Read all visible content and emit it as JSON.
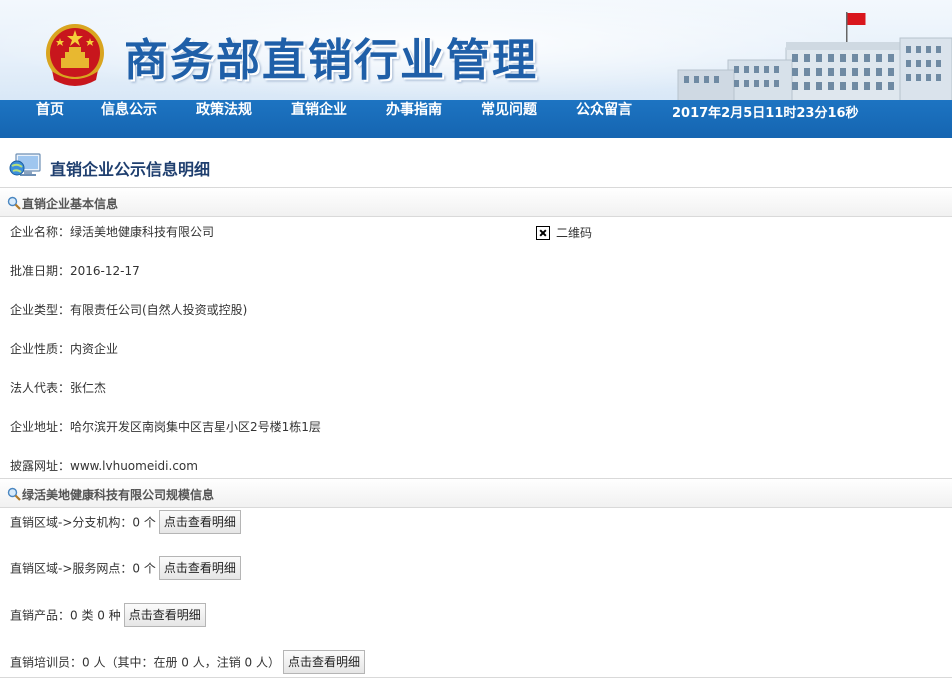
{
  "header": {
    "site_title": "商务部直销行业管理"
  },
  "nav": {
    "items": [
      "首页",
      "信息公示",
      "政策法规",
      "直销企业",
      "办事指南",
      "常见问题",
      "公众留言"
    ],
    "datetime": "2017年2月5日11时23分16秒"
  },
  "page": {
    "title": "直销企业公示信息明细"
  },
  "basic_info": {
    "section_title": "直销企业基本信息",
    "rows": [
      "企业名称：绿活美地健康科技有限公司",
      "批准日期：2016-12-17",
      "企业类型：有限责任公司(自然人投资或控股)",
      "企业性质：内资企业",
      "法人代表：张仁杰",
      "企业地址：哈尔滨开发区南岗集中区吉星小区2号楼1栋1层",
      "披露网址：www.lvhuomeidi.com"
    ],
    "qr_label": "二维码"
  },
  "scale_info": {
    "section_title": "绿活美地健康科技有限公司规模信息",
    "rows": [
      {
        "text": "直销区域->分支机构：0 个",
        "button": "点击查看明细"
      },
      {
        "text": "直销区域->服务网点：0 个",
        "button": "点击查看明细"
      },
      {
        "text": "直销产品：0 类 0 种",
        "button": "点击查看明细"
      },
      {
        "text": "直销培训员：0 人（其中：在册 0 人，注销 0 人）",
        "button": "点击查看明细"
      }
    ]
  },
  "colors": {
    "nav_bg": "#1565b1",
    "title_blue": "#1f5fa8",
    "page_title": "#1f3f6f"
  },
  "icons": [
    "national-emblem-icon",
    "computer-globe-icon",
    "magnifier-icon",
    "broken-image-icon"
  ]
}
